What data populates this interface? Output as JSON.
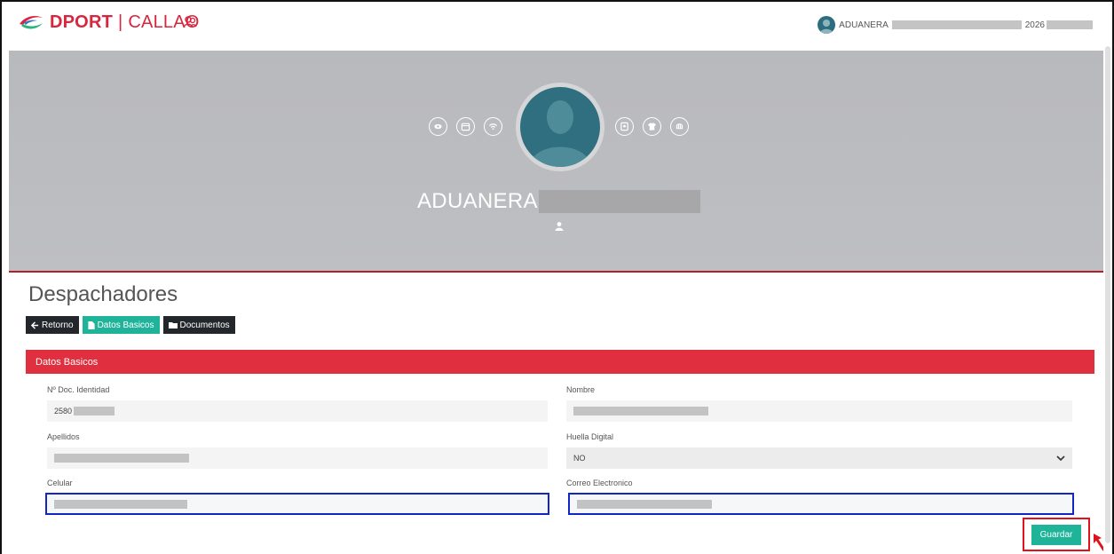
{
  "header": {
    "brand_primary": "DPORT",
    "brand_separator": "|",
    "brand_secondary": "CALLAO",
    "user_label": "ADUANERA",
    "user_year": "2026"
  },
  "banner": {
    "icons_left": [
      "eye-icon",
      "calendar-icon",
      "wifi-icon"
    ],
    "icons_right": [
      "id-badge-icon",
      "shirt-icon",
      "glove-icon"
    ],
    "profile_name": "ADUANERA"
  },
  "page": {
    "title": "Despachadores",
    "tabs": [
      {
        "label": "Retorno",
        "icon": "arrow-left-icon"
      },
      {
        "label": "Datos Basicos",
        "icon": "file-icon"
      },
      {
        "label": "Documentos",
        "icon": "folder-icon"
      }
    ]
  },
  "form": {
    "panel_title": "Datos Basicos",
    "doc_label": "Nº Doc. Identidad",
    "doc_value": "2580",
    "nombre_label": "Nombre",
    "apellidos_label": "Apellidos",
    "huella_label": "Huella Digital",
    "huella_value": "NO",
    "celular_label": "Celular",
    "correo_label": "Correo Electronico",
    "save_label": "Guardar"
  },
  "colors": {
    "brand_red": "#d7263d",
    "panel_red": "#e03040",
    "accent_green": "#1fb39a",
    "dark_button": "#23272b",
    "highlight_blue": "#1226c8",
    "highlight_red": "#e1121d"
  }
}
